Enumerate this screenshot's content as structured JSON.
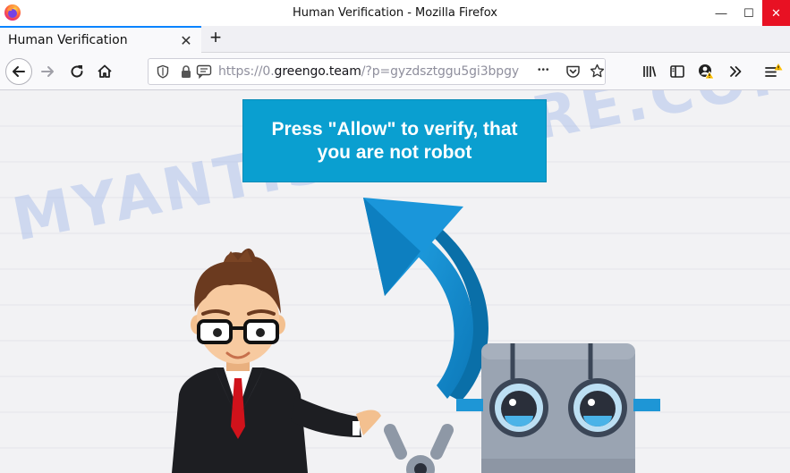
{
  "window": {
    "title": "Human Verification - Mozilla Firefox",
    "minimize_symbol": "—",
    "maximize_symbol": "☐",
    "close_symbol": "✕"
  },
  "tab": {
    "title": "Human Verification",
    "close_symbol": "✕",
    "new_tab_symbol": "+"
  },
  "urlbar": {
    "scheme": "https://0.",
    "host": "greengo.team",
    "path": "/?p=gyzdsztggu5gi3bpgy",
    "more_symbol": "•••"
  },
  "page": {
    "banner_text": "Press \"Allow\" to verify, that you are not robot",
    "watermark": "MYANTISPYWARE.COM"
  },
  "colors": {
    "banner": "#0a9fd0",
    "arrow": "#1a8fcf",
    "tab_accent": "#0a84ff",
    "close_button": "#e81123",
    "robot_body": "#9aa4b2",
    "tie": "#d0121b"
  },
  "icons": {
    "firefox_logo": "firefox-logo-icon",
    "back": "arrow-left-icon",
    "forward": "arrow-right-icon",
    "reload": "reload-icon",
    "home": "home-icon",
    "shield": "tracking-shield-icon",
    "lock": "lock-icon",
    "permissions": "permission-chat-icon",
    "pocket": "pocket-icon",
    "bookmark": "star-icon",
    "library": "library-icon",
    "sidebar": "sidebar-icon",
    "account": "account-warning-icon",
    "overflow": "chevron-double-right-icon",
    "menu": "hamburger-menu-icon"
  }
}
